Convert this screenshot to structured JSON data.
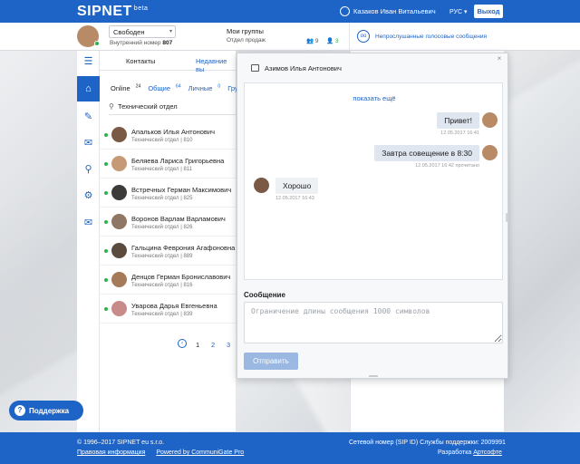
{
  "header": {
    "logo": "SIPNET",
    "logo_badge": "beta",
    "user_name": "Казаков Иван Витальевич",
    "lang": "РУС ▾",
    "logout": "Выход"
  },
  "status_bar": {
    "status": "Свободен",
    "ext_label": "Внутренний номер",
    "ext_number": "807",
    "groups_title": "Мои группы",
    "groups_sub": "Отдел продаж",
    "count_users": "9",
    "count_online": "3",
    "voicemail": "Непрослушанные голосовые сообщения"
  },
  "rail": {
    "items": [
      "home-icon",
      "notes-icon",
      "mail-icon",
      "contacts-icon",
      "settings-icon",
      "messages-icon"
    ]
  },
  "contacts_panel": {
    "tabs": [
      "Контакты",
      "Недавние вы"
    ],
    "filters": [
      {
        "label": "Online",
        "count": "24"
      },
      {
        "label": "Общие",
        "count": "64"
      },
      {
        "label": "Личные",
        "count": "0"
      },
      {
        "label": "Группы",
        "count": ""
      }
    ],
    "search_value": "Технический отдел",
    "contacts": [
      {
        "name": "Апальков Илья Антонович",
        "dept": "Технический отдел | 810"
      },
      {
        "name": "Беляева Лариса Григорьевна",
        "dept": "Технический отдел | 811"
      },
      {
        "name": "Встречных Герман Максимович",
        "dept": "Технический отдел | 825"
      },
      {
        "name": "Воронов Варлам Варламович",
        "dept": "Технический отдел | 826"
      },
      {
        "name": "Гальцина Феврония Агафоновна",
        "dept": "Технический отдел | 889"
      },
      {
        "name": "Денцов Герман Брониславович",
        "dept": "Технический отдел | 816"
      },
      {
        "name": "Уварова Дарья Евгеньевна",
        "dept": "Технический отдел | 839"
      }
    ],
    "pages": [
      "1",
      "2",
      "3"
    ]
  },
  "chat": {
    "title": "Азимов Илья Антонович",
    "show_more": "показать ещё",
    "messages": [
      {
        "text": "Привет!",
        "meta": "12.05.2017 16:41",
        "dir": "out"
      },
      {
        "text": "Завтра совещение в 8:30",
        "meta": "12.05.2017 16:42 прочитано",
        "dir": "out"
      },
      {
        "text": "Хорошо",
        "meta": "12.05.2017 16:43",
        "dir": "in"
      }
    ],
    "message_label": "Сообщение",
    "placeholder": "Ограничение длины сообщения 1000 символов",
    "send": "Отправить",
    "close": "×"
  },
  "support": "Поддержка",
  "footer": {
    "copyright": "© 1996–2017 SIPNET eu s.r.o.",
    "legal": "Правовая информация",
    "powered": "Powered by CommuniGate Pro",
    "sip_info": "Сетевой номер (SIP ID) Службы поддержки: 2009991",
    "dev_prefix": "Разработка",
    "dev_link": "Артсофте"
  },
  "colors": {
    "brand": "#1e63c6",
    "online": "#2ab34a"
  }
}
